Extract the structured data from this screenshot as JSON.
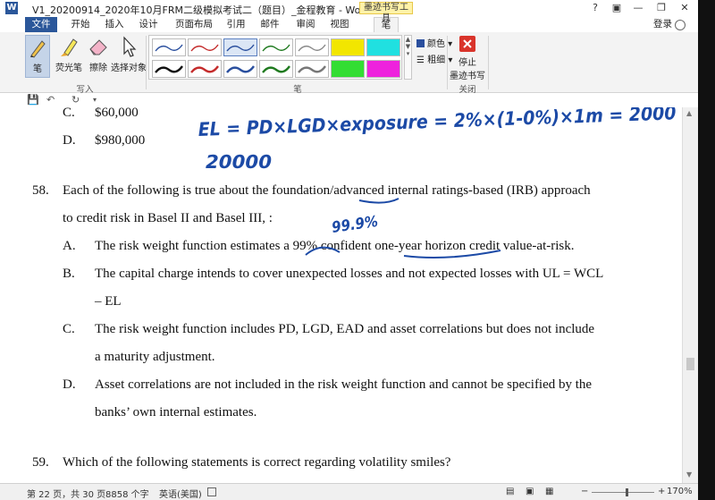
{
  "titlebar": {
    "app_icon": "W",
    "title": "V1_20200914_2020年10月FRM二级模拟考试二（题目）_金程教育 - Word",
    "help": "?",
    "ribbon_options": "▣",
    "minimize": "—",
    "restore": "❐",
    "close": "✕"
  },
  "tabs": [
    "文件",
    "开始",
    "插入",
    "设计",
    "页面布局",
    "引用",
    "邮件",
    "审阅",
    "视图",
    "笔"
  ],
  "context_tab": "墨迹书写工具",
  "login": "登录",
  "ribbon": {
    "write_group": {
      "label": "写入",
      "buttons": [
        {
          "label": "笔",
          "icon": "pen-icon"
        },
        {
          "label": "荧光笔",
          "icon": "highlighter-icon"
        },
        {
          "label": "擦除",
          "icon": "eraser-icon"
        },
        {
          "label": "选择对象",
          "icon": "select-object-icon"
        }
      ]
    },
    "pens_group": {
      "label": "笔",
      "color_label": "颜色",
      "thickness_label": "粗细"
    },
    "close_group": {
      "label": "关闭",
      "stop_line1": "停止",
      "stop_line2": "墨迹书写"
    },
    "pen_colors": [
      "#2a4f9e",
      "#c42b2b",
      "#2a4f9e",
      "#1f7a1f",
      "#888888",
      "#f2e600",
      "#20e0e0",
      "#111111",
      "#c42b2b",
      "#2a4f9e",
      "#1f7a1f",
      "#777777",
      "#33dd33",
      "#ee22dd"
    ]
  },
  "qat": {
    "save": "💾",
    "undo": "↶",
    "redo": "↻",
    "customize": "▾"
  },
  "document": {
    "opt_c_label": "C.",
    "opt_c_value": "$60,000",
    "opt_d_label": "D.",
    "opt_d_value": "$980,000",
    "q58_number": "58.",
    "q58_line1": "Each of the following is true about the foundation/advanced internal ratings-based (IRB) approach",
    "q58_line2": "to credit risk in Basel II and Basel III, :",
    "q58_options": [
      {
        "label": "A.",
        "lines": [
          "The risk weight function estimates a 99% confident one-year horizon credit value-at-risk."
        ]
      },
      {
        "label": "B.",
        "lines": [
          "The capital charge intends to cover unexpected losses and not expected losses with UL = WCL",
          "– EL"
        ]
      },
      {
        "label": "C.",
        "lines": [
          "The risk weight function includes PD, LGD, EAD and asset correlations but does not include",
          "a maturity adjustment."
        ]
      },
      {
        "label": "D.",
        "lines": [
          "Asset correlations are not included in the risk weight function and cannot be specified by the",
          "banks’ own internal estimates."
        ]
      }
    ],
    "q59_number": "59.",
    "q59_text": "Which of the following statements is correct regarding volatility smiles?"
  },
  "ink": {
    "formula": "EL = PD×LGD×exposure = 2%×(1-0%)×1m = 2000",
    "result": "20000",
    "confidence": "99.9%",
    "color": "#1c4aa6"
  },
  "statusbar": {
    "page": "第 22 页，共 30 页",
    "words": "8858 个字",
    "language": "英语(美国)",
    "zoom_out": "−",
    "zoom_in": "+",
    "zoom": "170%"
  }
}
